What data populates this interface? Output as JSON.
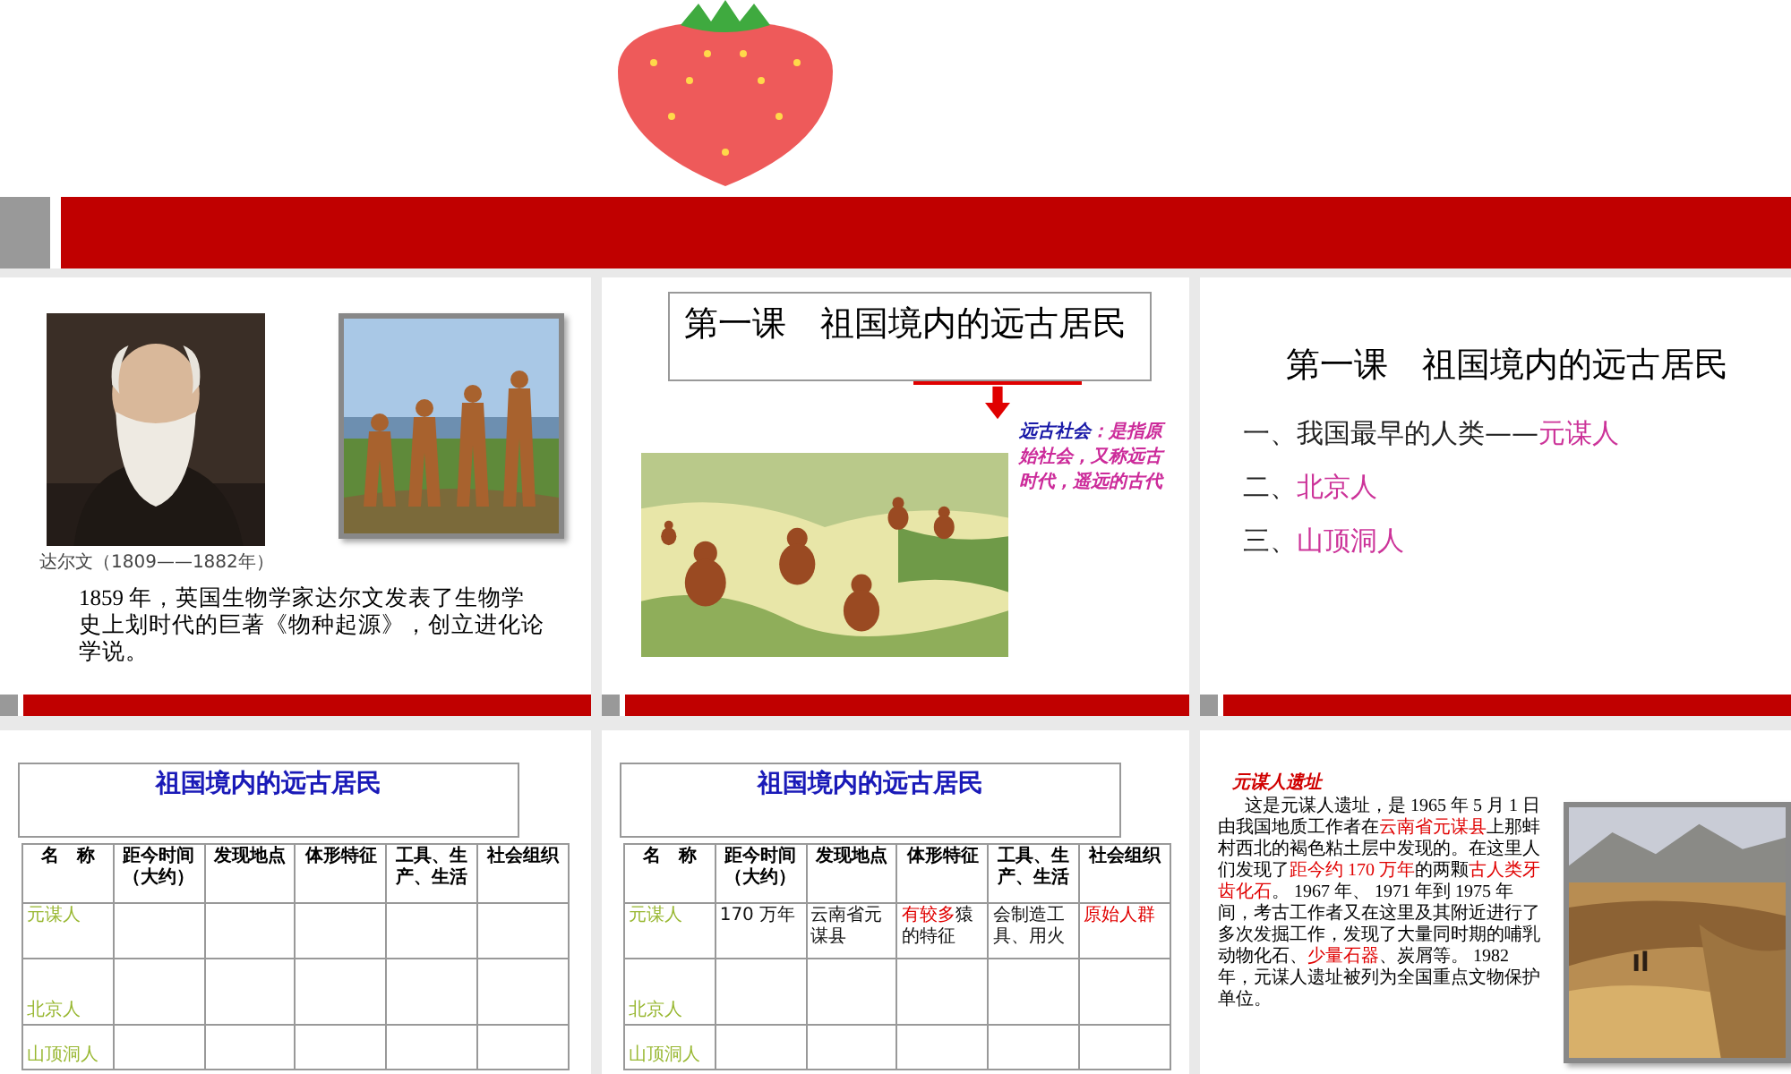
{
  "banner": {
    "kind": "strawberry"
  },
  "slides": [
    {
      "kind": "intro",
      "caption": "达尔文（1809——1882年）",
      "paragraph": "1859 年，英国生物学家达尔文发表了生物学史上划时代的巨著《物种起源》，创立进化论学说。"
    },
    {
      "kind": "title-picture",
      "title": "第一课　祖国境内的远古居民",
      "note": [
        {
          "text": "远古社会",
          "accent": true
        },
        {
          "text": "：是指原始社会，又称远古时代，遥远的古代",
          "accent": false
        }
      ]
    },
    {
      "kind": "outline",
      "title": "第一课　祖国境内的远古居民",
      "items": [
        {
          "segments": [
            {
              "text": "一、我国最早的人类——",
              "accent": false
            },
            {
              "text": "元谋人",
              "accent": true
            }
          ]
        },
        {
          "segments": [
            {
              "text": "二、",
              "accent": false
            },
            {
              "text": "北京人",
              "accent": true
            }
          ]
        },
        {
          "segments": [
            {
              "text": "三、",
              "accent": false
            },
            {
              "text": "山顶洞人",
              "accent": true
            }
          ]
        }
      ]
    },
    {
      "kind": "table",
      "title": "祖国境内的远古居民",
      "columns": [
        "名　称",
        "距今时间（大约）",
        "发现地点",
        "体形特征",
        "工具、生产、生活",
        "社会组织"
      ],
      "rows": [
        {
          "name": "元谋人"
        },
        {
          "name": "北京人"
        },
        {
          "name": "山顶洞人"
        }
      ]
    },
    {
      "kind": "table",
      "title": "祖国境内的远古居民",
      "columns": [
        "名　称",
        "距今时间（大约）",
        "发现地点",
        "体形特征",
        "工具、生产、生活",
        "社会组织"
      ],
      "rows": [
        {
          "name": "元谋人",
          "cells": [
            {
              "segments": [
                {
                  "text": "170 万年",
                  "accent": false
                }
              ]
            },
            {
              "segments": [
                {
                  "text": "云南省元谋县",
                  "accent": false
                }
              ]
            },
            {
              "segments": [
                {
                  "text": "有较多",
                  "accent": true
                },
                {
                  "text": "猿的特征",
                  "accent": false
                }
              ]
            },
            {
              "segments": [
                {
                  "text": "会制造工具、用火",
                  "accent": false
                }
              ]
            },
            {
              "segments": [
                {
                  "text": "原始人群",
                  "accent": true
                }
              ]
            }
          ]
        },
        {
          "name": "北京人"
        },
        {
          "name": "山顶洞人"
        }
      ]
    },
    {
      "kind": "article",
      "heading": "元谋人遗址",
      "segments": [
        {
          "text": "这是元谋人遗址，是 1965 年 5 月 1 日由我国地质工作者在",
          "accent": false
        },
        {
          "text": "云南省元谋县",
          "accent": true
        },
        {
          "text": "上那蚌村西北的褐色粘土层中发现的。在这里人们发现了",
          "accent": false
        },
        {
          "text": "距今约 170 万年",
          "accent": true
        },
        {
          "text": "的两颗",
          "accent": false
        },
        {
          "text": "古人类牙齿化石",
          "accent": true
        },
        {
          "text": "。 1967 年、 1971 年到 1975 年间，考古工作者又在这里及其附近进行了多次发掘工作，发现了大量同时期的哺乳动物化石、",
          "accent": false
        },
        {
          "text": "少量石器",
          "accent": true
        },
        {
          "text": "、炭屑等。 1982 年，元谋人遗址被列为全国重点文物保护单位。",
          "accent": false
        }
      ]
    }
  ]
}
